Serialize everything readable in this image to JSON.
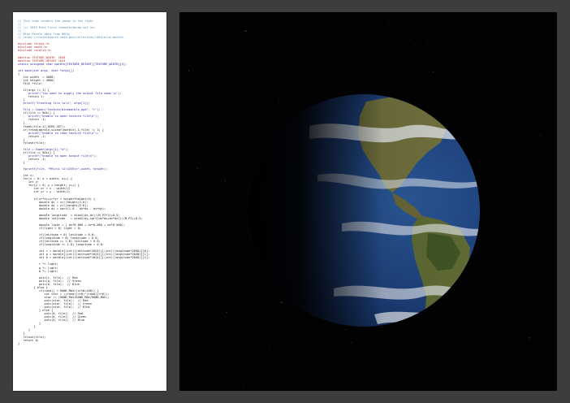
{
  "code_listing": {
    "lines": [
      {
        "k": "com",
        "t": "// This code renders the image to the right"
      },
      {
        "k": "com",
        "t": "//"
      },
      {
        "k": "com",
        "t": "// (c) 2019 Mike Field <hamster@snap.net.nz>"
      },
      {
        "k": "com",
        "t": "//"
      },
      {
        "k": "com",
        "t": "// Blue Marble data from NASA:"
      },
      {
        "k": "com",
        "t": "// https://visibleearth.nasa.gov/collection/1484/blue-marble"
      },
      {
        "k": "txt",
        "t": ""
      },
      {
        "k": "pre",
        "t": "#include <stdio.h>"
      },
      {
        "k": "pre",
        "t": "#include <math.h>"
      },
      {
        "k": "pre",
        "t": "#include <stdlib.h>"
      },
      {
        "k": "txt",
        "t": ""
      },
      {
        "k": "pre",
        "t": "#define TEXTURE_WIDTH  2048"
      },
      {
        "k": "pre",
        "t": "#define TEXTURE_HEIGHT 1024"
      },
      {
        "k": "kw",
        "t": "static unsigned char marble[TEXTURE_HEIGHT][TEXTURE_WIDTH][3];"
      },
      {
        "k": "txt",
        "t": ""
      },
      {
        "k": "kw",
        "t": "int main(int argc, char *argv[])"
      },
      {
        "k": "txt",
        "t": "{"
      },
      {
        "k": "txt",
        "t": "   int width  = 4000;"
      },
      {
        "k": "txt",
        "t": "   int height = 4000;"
      },
      {
        "k": "txt",
        "t": "   FILE *file;"
      },
      {
        "k": "txt",
        "t": ""
      },
      {
        "k": "txt",
        "t": "   if(argc != 2) {"
      },
      {
        "k": "str",
        "t": "      printf(\"You need to supply the output file name.\\n\");"
      },
      {
        "k": "txt",
        "t": "      return 1;"
      },
      {
        "k": "txt",
        "t": "   }"
      },
      {
        "k": "str",
        "t": "   printf(\"Creating file %s\\n\", argv[1]);"
      },
      {
        "k": "txt",
        "t": ""
      },
      {
        "k": "str",
        "t": "   file = fopen(\"texture/bluemarble.ppm\", \"r\");"
      },
      {
        "k": "txt",
        "t": "   if(file == NULL) {"
      },
      {
        "k": "str",
        "t": "      printf(\"Unable to open texture file\\n\");"
      },
      {
        "k": "txt",
        "t": "      return -1;"
      },
      {
        "k": "txt",
        "t": "   }"
      },
      {
        "k": "txt",
        "t": "   fseek(file,17,SEEK_SET);"
      },
      {
        "k": "txt",
        "t": "   if(fread(marble,sizeof(marble),1,file) != 1) {"
      },
      {
        "k": "str",
        "t": "      printf(\"Unable to read texture file\\n\");"
      },
      {
        "k": "txt",
        "t": "      return -1;"
      },
      {
        "k": "txt",
        "t": "   }"
      },
      {
        "k": "txt",
        "t": "   fclose(file);"
      },
      {
        "k": "txt",
        "t": ""
      },
      {
        "k": "str",
        "t": "   file = fopen(argv[1],\"w\");"
      },
      {
        "k": "txt",
        "t": "   if(file == NULL) {"
      },
      {
        "k": "str",
        "t": "      printf(\"Unable to open output file\\n\");"
      },
      {
        "k": "txt",
        "t": "      return -1;"
      },
      {
        "k": "txt",
        "t": "   }"
      },
      {
        "k": "txt",
        "t": ""
      },
      {
        "k": "str",
        "t": "   fprintf(file, \"P6\\n%i %i\\n255\\n\",width, height);"
      },
      {
        "k": "txt",
        "t": ""
      },
      {
        "k": "txt",
        "t": "   int x;"
      },
      {
        "k": "txt",
        "t": "   for(x = 0; x < width; x++) {"
      },
      {
        "k": "txt",
        "t": "      int y;"
      },
      {
        "k": "txt",
        "t": "      for(y = 0; y < height; y++) {"
      },
      {
        "k": "txt",
        "t": "         int xr = x - width/2;"
      },
      {
        "k": "txt",
        "t": "         int yr = y - width/2;"
      },
      {
        "k": "txt",
        "t": ""
      },
      {
        "k": "txt",
        "t": "         if(xr*xr+yr*yr < height*height/4) {"
      },
      {
        "k": "txt",
        "t": "            double dx = xr/(height/2.0);"
      },
      {
        "k": "txt",
        "t": "            double dy = yr/(height/2.0);"
      },
      {
        "k": "txt",
        "t": "            double dz = sqrt(1.0 - dx*dx - dy*dy);"
      },
      {
        "k": "txt",
        "t": ""
      },
      {
        "k": "txt",
        "t": "            double longitude  = atan2(dx,dz)/(M_PI*2)+0.5;"
      },
      {
        "k": "txt",
        "t": "            double latitude   = atan2(dy,sqrt(dx*dx+dz*dz))/(M_PI)+0.5;"
      },
      {
        "k": "txt",
        "t": ""
      },
      {
        "k": "txt",
        "t": "            double light = ( dx*0.866 + dz*0.866 + dz*0.500);"
      },
      {
        "k": "txt",
        "t": "            if(light < 0) light = 0;"
      },
      {
        "k": "txt",
        "t": ""
      },
      {
        "k": "txt",
        "t": "            if(latitude < 0) latitude = 0.0;"
      },
      {
        "k": "txt",
        "t": "            if(longitude < 0) longitude = 0.0;"
      },
      {
        "k": "txt",
        "t": "            if(latitude >= 1.0) latitude = 0.0;"
      },
      {
        "k": "txt",
        "t": "            if(longitude >= 1.0) longitude = 0.0;"
      },
      {
        "k": "txt",
        "t": ""
      },
      {
        "k": "txt",
        "t": "            int r = marble[(int)(latitude*1024)][(int)(longitude*2048)][0];"
      },
      {
        "k": "txt",
        "t": "            int g = marble[(int)(latitude*1024)][(int)(longitude*2048)][1];"
      },
      {
        "k": "txt",
        "t": "            int b = marble[(int)(latitude*1024)][(int)(longitude*2048)][2];"
      },
      {
        "k": "txt",
        "t": ""
      },
      {
        "k": "txt",
        "t": "            r *= light;"
      },
      {
        "k": "txt",
        "t": "            g *= light;"
      },
      {
        "k": "txt",
        "t": "            b *= light;"
      },
      {
        "k": "txt",
        "t": ""
      },
      {
        "k": "txt",
        "t": "            putc(r, file);  // Red"
      },
      {
        "k": "txt",
        "t": "            putc(g, file);  // Green"
      },
      {
        "k": "txt",
        "t": "            putc(b, file);  // Blue"
      },
      {
        "k": "txt",
        "t": "         } else {"
      },
      {
        "k": "txt",
        "t": "            if(rand() < RAND_MAX/(xr%8+100)) {"
      },
      {
        "k": "txt",
        "t": "               int star = ((rand()>>8)^(rand()>>6));"
      },
      {
        "k": "txt",
        "t": "               star /= (RAND_MAX/RAND_MAX/RAND_MAX);"
      },
      {
        "k": "txt",
        "t": "               putc(star, file);  // Red"
      },
      {
        "k": "txt",
        "t": "               putc(star, file);  // Green"
      },
      {
        "k": "txt",
        "t": "               putc(star, file);  // Blue"
      },
      {
        "k": "txt",
        "t": "            } else {"
      },
      {
        "k": "txt",
        "t": "               putc(0, file);  // Red"
      },
      {
        "k": "txt",
        "t": "               putc(0, file);  // Green"
      },
      {
        "k": "txt",
        "t": "               putc(0, file);  // Blue"
      },
      {
        "k": "txt",
        "t": "            }"
      },
      {
        "k": "txt",
        "t": "         }"
      },
      {
        "k": "txt",
        "t": "      }"
      },
      {
        "k": "txt",
        "t": "   }"
      },
      {
        "k": "txt",
        "t": "   fclose(file);"
      },
      {
        "k": "txt",
        "t": "   return 0;"
      },
      {
        "k": "txt",
        "t": "}"
      }
    ]
  },
  "colors": {
    "comment": "#4f8fbf",
    "preprocessor": "#b03030",
    "keyword": "#1a1a9a",
    "string": "#2a2aa0",
    "ocean": "#1c3e78",
    "land": "#6b6a3c",
    "cloud": "#e8ecf2"
  },
  "render": {
    "globe_icon": "earth-globe-icon"
  }
}
